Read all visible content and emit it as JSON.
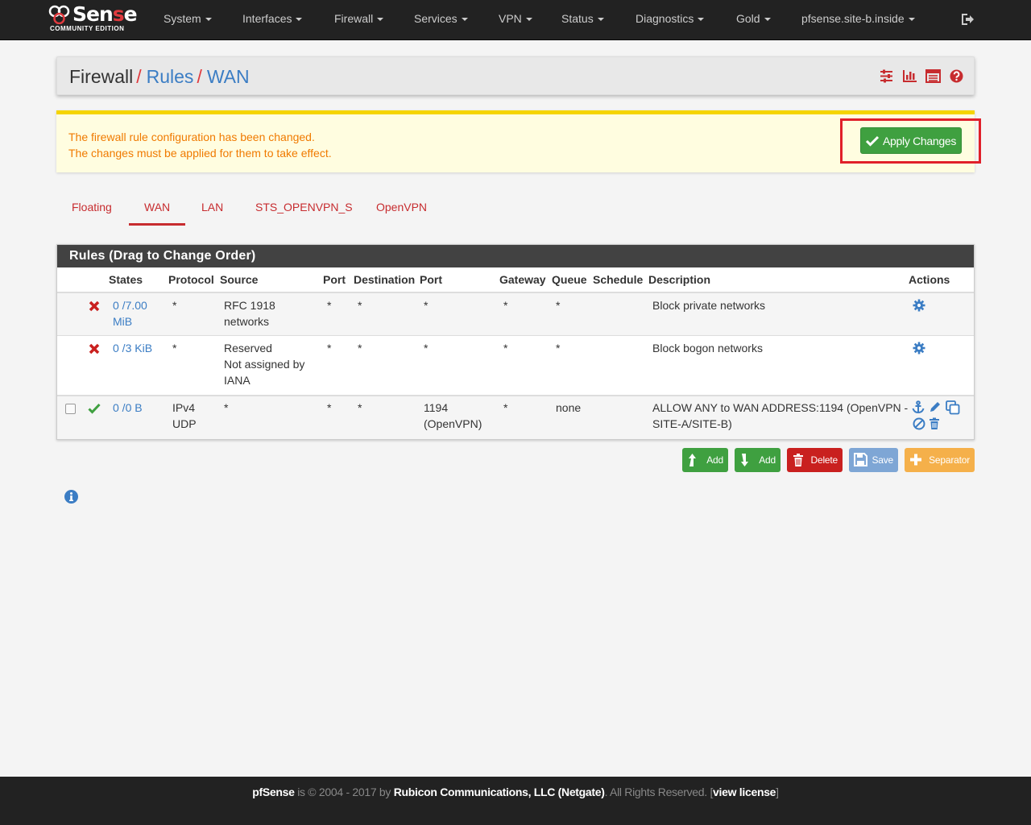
{
  "brand": {
    "word_a": "Sen",
    "word_b": "s",
    "word_c": "e",
    "subtitle": "COMMUNITY EDITION"
  },
  "nav": {
    "items": [
      "System",
      "Interfaces",
      "Firewall",
      "Services",
      "VPN",
      "Status",
      "Diagnostics",
      "Gold",
      "pfsense.site-b.inside"
    ],
    "logout_icon": "sign-out-icon"
  },
  "breadcrumb": {
    "part1": "Firewall",
    "sep": "/",
    "part2": "Rules",
    "part3": "WAN"
  },
  "alert": {
    "line1": "The firewall rule configuration has been changed.",
    "line2": "The changes must be applied for them to take effect.",
    "apply_label": "Apply Changes"
  },
  "tabs": [
    "Floating",
    "WAN",
    "LAN",
    "STS_OPENVPN_S",
    "OpenVPN"
  ],
  "active_tab": "WAN",
  "rules": {
    "heading": "Rules (Drag to Change Order)",
    "columns": [
      "States",
      "Protocol",
      "Source",
      "Port",
      "Destination",
      "Port",
      "Gateway",
      "Queue",
      "Schedule",
      "Description",
      "Actions"
    ],
    "rows": [
      {
        "status": "block",
        "states_a": "0 /7.00",
        "states_b": "MiB",
        "protocol": "*",
        "source_a": "RFC 1918",
        "source_b": "networks",
        "source_c": "",
        "src_port": "*",
        "destination": "*",
        "dst_port_a": "*",
        "dst_port_b": "",
        "gateway": "*",
        "queue": "*",
        "description_a": "Block private networks",
        "description_b": ""
      },
      {
        "status": "block",
        "states_a": "0 /3 KiB",
        "states_b": "",
        "protocol": "*",
        "source_a": "Reserved",
        "source_b": "Not assigned by",
        "source_c": "IANA",
        "src_port": "*",
        "destination": "*",
        "dst_port_a": "*",
        "dst_port_b": "",
        "gateway": "*",
        "queue": "*",
        "description_a": "Block bogon networks",
        "description_b": ""
      },
      {
        "status": "pass",
        "states_a": "0 /0 B",
        "states_b": "",
        "protocol_a": "IPv4",
        "protocol_b": "UDP",
        "source_a": "*",
        "src_port": "*",
        "destination": "*",
        "dst_port_a": "1194",
        "dst_port_b": "(OpenVPN)",
        "gateway": "*",
        "queue": "none",
        "description_a": "ALLOW ANY to WAN ADDRESS:1194 (OpenVPN -",
        "description_b": "SITE-A/SITE-B)"
      }
    ]
  },
  "buttons": {
    "add_top": "Add",
    "add_bottom": "Add",
    "delete": "Delete",
    "save": "Save",
    "separator": "Separator"
  },
  "footer": {
    "name": "pfSense",
    "is": "is © 2004 - 2017 by",
    "company": "Rubicon Communications, LLC (Netgate)",
    "rights": ". All Rights Reserved. [",
    "license": "view license",
    "close": "]"
  },
  "colors": {
    "accent_red": "#c72c2f",
    "link_blue": "#3b7dc4",
    "success_green": "#3fa040",
    "alert_orange": "#f07a00",
    "alert_yellow": "#f5d400"
  }
}
